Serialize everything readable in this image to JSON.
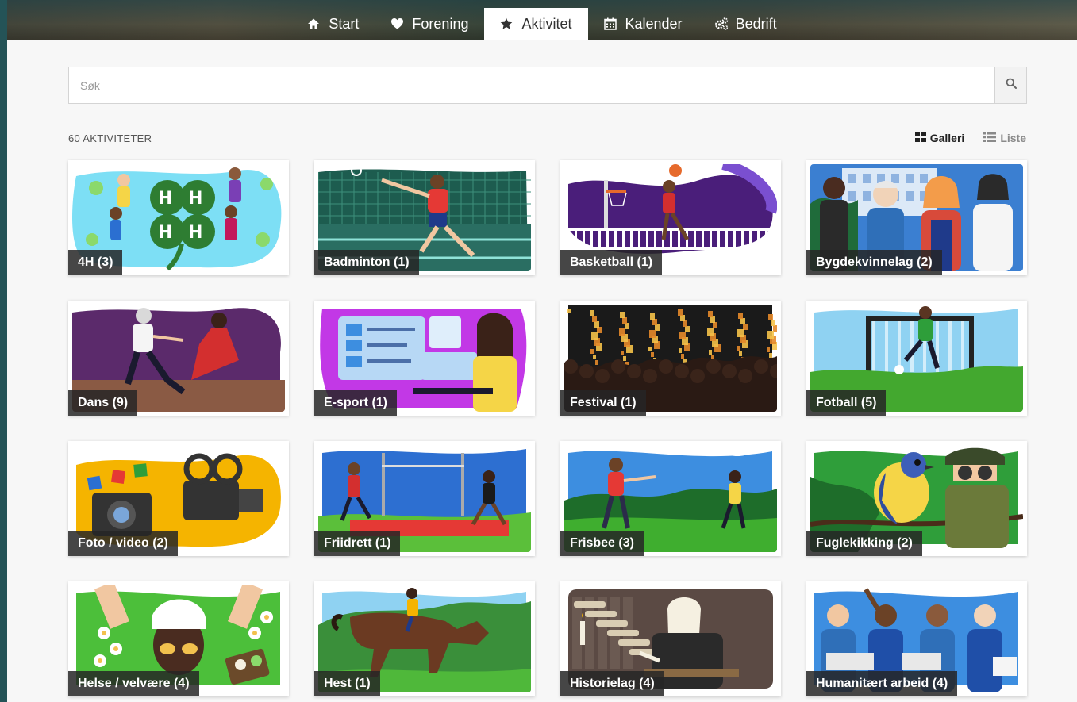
{
  "nav": {
    "items": [
      {
        "label": "Start",
        "icon": "home-icon",
        "active": false
      },
      {
        "label": "Forening",
        "icon": "heart-icon",
        "active": false
      },
      {
        "label": "Aktivitet",
        "icon": "star-icon",
        "active": true
      },
      {
        "label": "Kalender",
        "icon": "calendar-icon",
        "active": false
      },
      {
        "label": "Bedrift",
        "icon": "gears-icon",
        "active": false
      }
    ]
  },
  "search": {
    "placeholder": "Søk",
    "value": ""
  },
  "count_label": "60 AKTIVITETER",
  "view": {
    "gallery_label": "Galleri",
    "list_label": "Liste",
    "selected": "Galleri"
  },
  "colors": {
    "accent_dark": "#262626",
    "page_bg": "#f7f7f7",
    "frame": "#2a5a5e"
  },
  "activities": [
    {
      "label": "4H (3)",
      "icon": "clover-icon",
      "palette": [
        "#7ddff5",
        "#2e7d32",
        "#8bd96b"
      ]
    },
    {
      "label": "Badminton (1)",
      "icon": "badminton-icon",
      "palette": [
        "#1d5c4f",
        "#e53935",
        "#8fe3d8"
      ]
    },
    {
      "label": "Basketball (1)",
      "icon": "basketball-icon",
      "palette": [
        "#4a1e7a",
        "#e66a2c",
        "#b7a6ea"
      ]
    },
    {
      "label": "Bygdekvinnelag (2)",
      "icon": "women-group-icon",
      "palette": [
        "#3b7fd1",
        "#f39c4a",
        "#1f6b3a"
      ]
    },
    {
      "label": "Dans (9)",
      "icon": "dance-icon",
      "palette": [
        "#5b2a6b",
        "#d32f2f",
        "#8a5a44"
      ]
    },
    {
      "label": "E-sport (1)",
      "icon": "gaming-icon",
      "palette": [
        "#c238e6",
        "#7ec8f5",
        "#f5d547"
      ]
    },
    {
      "label": "Festival (1)",
      "icon": "festival-icon",
      "palette": [
        "#1a1a1a",
        "#e6892a",
        "#f5c249"
      ]
    },
    {
      "label": "Fotball (5)",
      "icon": "football-icon",
      "palette": [
        "#8fd2f2",
        "#43a82f",
        "#f4f4f4"
      ]
    },
    {
      "label": "Foto / video (2)",
      "icon": "camera-icon",
      "palette": [
        "#f5b400",
        "#333333",
        "#e53935"
      ]
    },
    {
      "label": "Friidrett (1)",
      "icon": "athletics-icon",
      "palette": [
        "#2d6fd1",
        "#5bbf3a",
        "#e53935"
      ]
    },
    {
      "label": "Frisbee (3)",
      "icon": "frisbee-icon",
      "palette": [
        "#3d8ee0",
        "#3fae2f",
        "#1e6d2a"
      ]
    },
    {
      "label": "Fuglekikking (2)",
      "icon": "bird-icon",
      "palette": [
        "#2f9e3a",
        "#f5d547",
        "#3d5fb8"
      ]
    },
    {
      "label": "Helse / velvære (4)",
      "icon": "spa-icon",
      "palette": [
        "#4cbf3a",
        "#f2c14e",
        "#ffffff"
      ]
    },
    {
      "label": "Hest (1)",
      "icon": "horse-icon",
      "palette": [
        "#8fd2f2",
        "#3a8f3a",
        "#6b3a22"
      ]
    },
    {
      "label": "Historielag (4)",
      "icon": "history-icon",
      "palette": [
        "#5b4a44",
        "#f5f0e1",
        "#2a2a2a"
      ]
    },
    {
      "label": "Humanitært arbeid (4)",
      "icon": "charity-icon",
      "palette": [
        "#3d8ee0",
        "#1f4fa8",
        "#e8e8e8"
      ]
    }
  ]
}
